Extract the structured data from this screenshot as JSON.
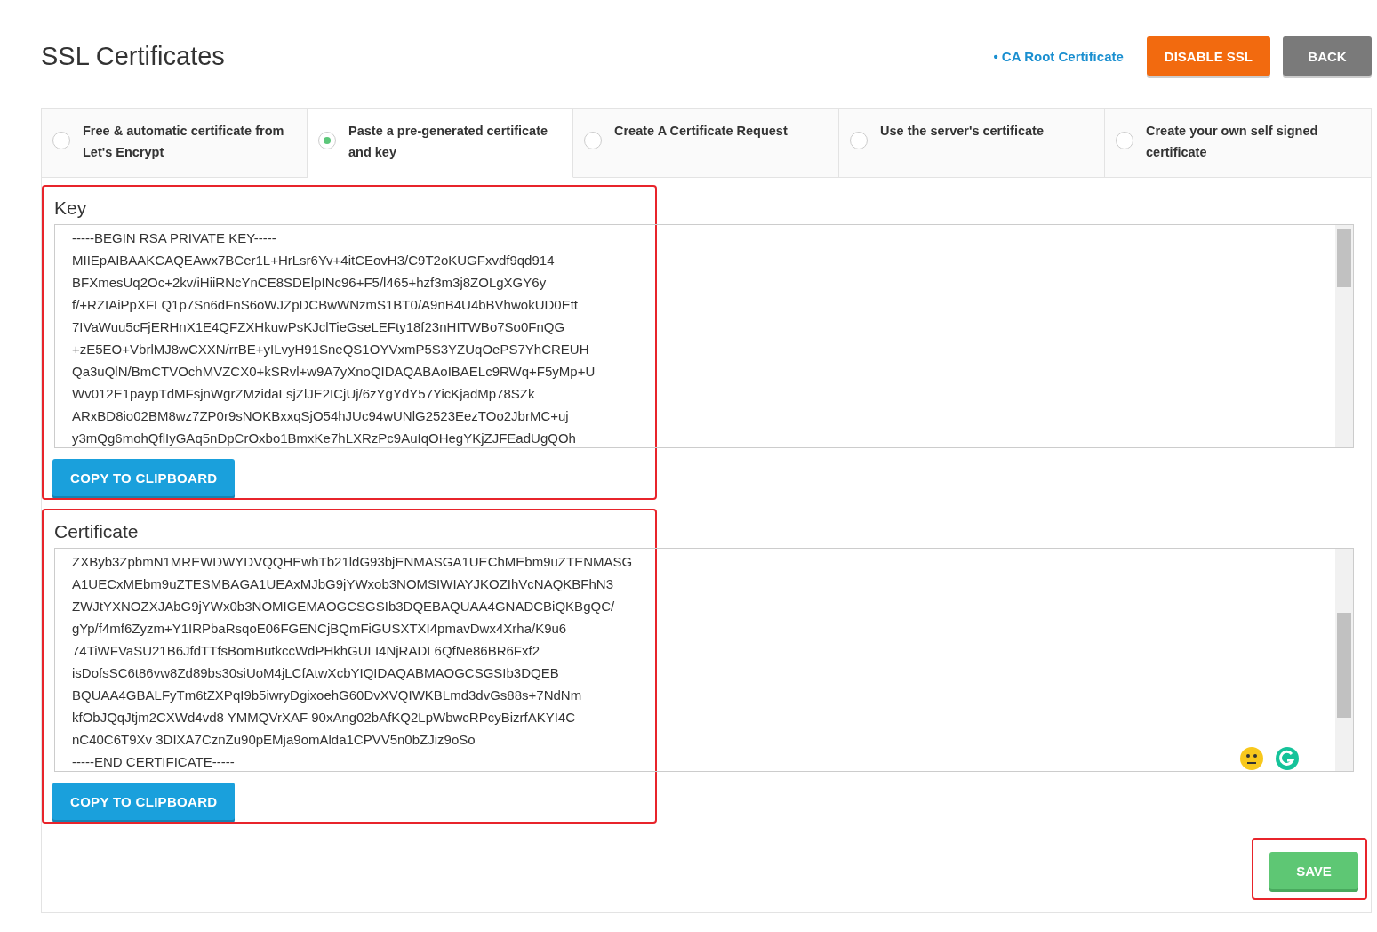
{
  "title": "SSL Certificates",
  "header_link": "• CA Root Certificate",
  "header_buttons": [
    {
      "label": "DISABLE SSL",
      "kind": "warning"
    },
    {
      "label": "BACK",
      "kind": "neutral"
    }
  ],
  "tabs": [
    {
      "label": "Free & automatic certificate from Let's Encrypt",
      "selected": false
    },
    {
      "label": "Paste a pre-generated certificate and key",
      "selected": true
    },
    {
      "label": "Create A Certificate Request",
      "selected": false
    },
    {
      "label": "Use the server's certificate",
      "selected": false
    },
    {
      "label": "Create your own self signed certificate",
      "selected": false
    }
  ],
  "sections": [
    {
      "label": "Key",
      "highlighted": true,
      "button": "COPY TO CLIPBOARD",
      "extras": false,
      "lines": [
        "-----BEGIN RSA PRIVATE KEY-----",
        "MIIEpAIBAAKCAQEAwx7BCer1L+HrLsr6Yv+4itCEovH3/C9T2oKUGFxvdf9qd914",
        "BFXmesUq2Oc+2kv/iHiiRNcYnCE8SDElpINc96+F5/l465+hzf3m3j8ZOLgXGY6y",
        "f/+RZIAiPpXFLQ1p7Sn6dFnS6oWJZpDCBwWNzmS1BT0/A9nB4U4bBVhwokUD0Ett",
        "7IVaWuu5cFjERHnX1E4QFZXHkuwPsKJclTieGseLEFty18f23nHITWBo7So0FnQG",
        "+zE5EO+VbrlMJ8wCXXN/rrBE+yILvyH91SneQS1OYVxmP5S3YZUqOePS7YhCREUH",
        "Qa3uQlN/BmCTVOchMVZCX0+kSRvl+w9A7yXnoQIDAQABAoIBAELc9RWq+F5yMp+U",
        "Wv012E1paypTdMFsjnWgrZMzidaLsjZlJE2ICjUj/6zYgYdY57YicKjadMp78SZk",
        "ARxBD8io02BM8wz7ZP0r9sNOKBxxqSjO54hJUc94wUNlG2523EezTOo2JbrMC+uj",
        "y3mQg6mohQflIyGAq5nDpCrOxbo1BmxKe7hLXRzPc9AuIqOHegYKjZJFEadUgQOh"
      ]
    },
    {
      "label": "Certificate",
      "highlighted": true,
      "button": "COPY TO CLIPBOARD",
      "extras": true,
      "lines": [
        "ZXByb3ZpbmN1MREWDWYDVQQHEwhTb21ldG93bjENMASGA1UEChMEbm9uZTENMASG",
        "A1UECxMEbm9uZTESMBAGA1UEAxMJbG9jYWxob3NOMSIWIAYJKOZIhVcNAQKBFhN3",
        "ZWJtYXNOZXJAbG9jYWx0b3NOMIGEMAOGCSGSIb3DQEBAQUAA4GNADCBiQKBgQC/",
        "gYp/f4mf6Zyzm+Y1IRPbaRsqoE06FGENCjBQmFiGUSXTXI4pmavDwx4Xrha/K9u6",
        "74TiWFVaSU21B6JfdTTfsBomButkccWdPHkhGULI4NjRADL6QfNe86BR6Fxf2",
        "isDofsSC6t86vw8Zd89bs30siUoM4jLCfAtwXcbYIQIDAQABMAOGCSGSIb3DQEB",
        "BQUAA4GBALFyTm6tZXPqI9b5iwryDgixoehG60DvXVQIWKBLmd3dvGs88s+7NdNm",
        "kfObJQqJtjm2CXWd4vd8 YMMQVrXAF 90xAng02bAfKQ2LpWbwcRPcyBizrfAKYI4C",
        "nC40C6T9Xv 3DIXA7CznZu90pEMja9omAlda1CPVV5n0bZJiz9oSo",
        "-----END CERTIFICATE-----"
      ]
    }
  ],
  "save": {
    "label": "SAVE",
    "highlighted": true
  }
}
